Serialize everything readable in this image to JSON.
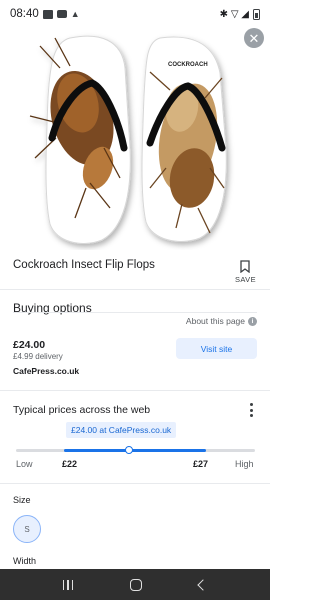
{
  "status_bar": {
    "time": "08:40",
    "right_text": "✱ ▽ ◢"
  },
  "product": {
    "image_label": "COCKROACH",
    "title": "Cockroach Insect Flip Flops",
    "save_label": "SAVE",
    "close_glyph": "✕"
  },
  "buying_options": {
    "title": "Buying options",
    "about_link": "About this page",
    "offer": {
      "price": "£24.00",
      "delivery": "£4.99 delivery",
      "store": "CafePress.co.uk",
      "visit_label": "Visit site"
    }
  },
  "typical_prices": {
    "title": "Typical prices across the web",
    "tooltip": "£24.00 at CafePress.co.uk",
    "low_label": "Low",
    "high_label": "High",
    "low_value": "£22",
    "high_value": "£27",
    "current_fraction": 0.46
  },
  "size": {
    "label": "Size",
    "selected": "S"
  },
  "width": {
    "label": "Width"
  },
  "colors": {
    "accent": "#1a73e8",
    "accent_light": "#e8f0fe",
    "nav_bar": "#2f2f2f"
  }
}
